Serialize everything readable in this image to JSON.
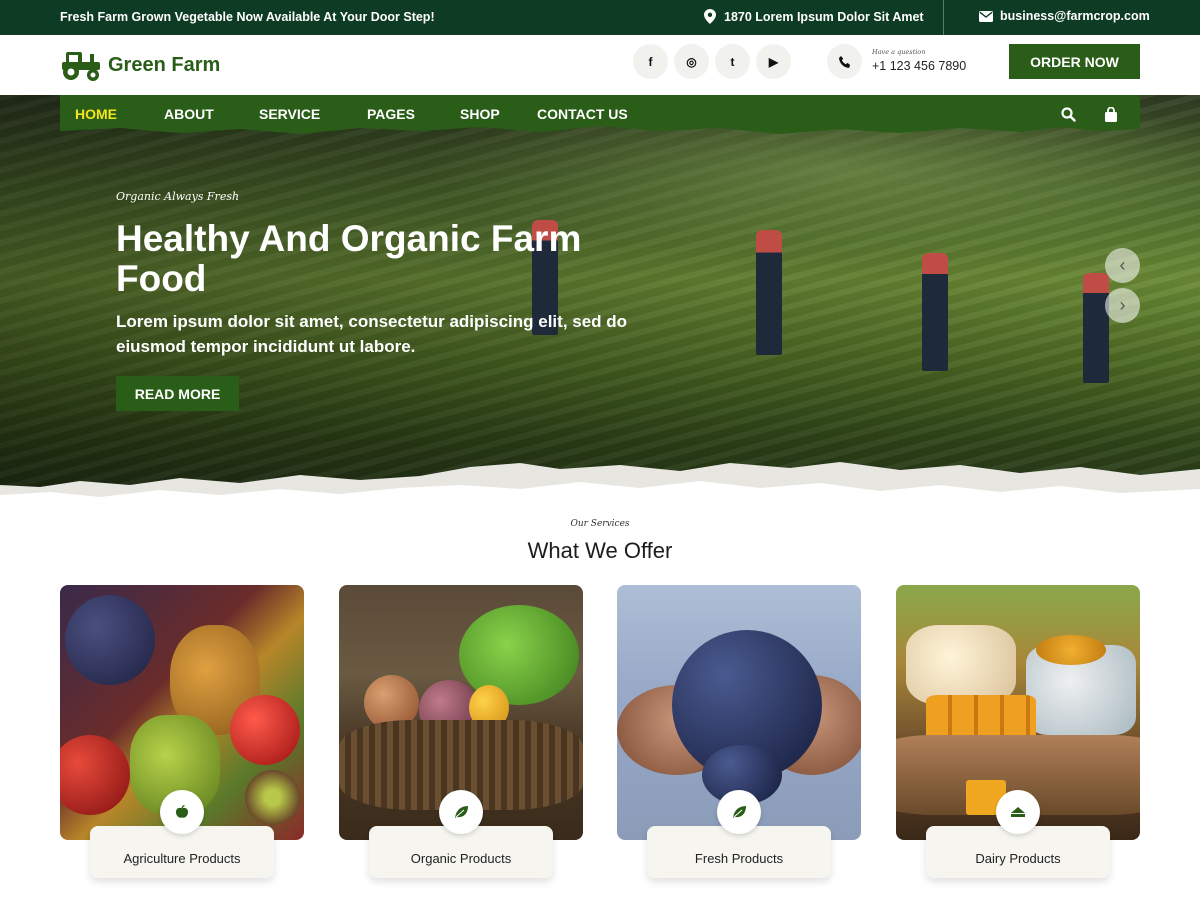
{
  "topbar": {
    "tagline": "Fresh Farm Grown Vegetable Now Available At Your Door Step!",
    "address": "1870 Lorem Ipsum Dolor Sit Amet",
    "email": "business@farmcrop.com"
  },
  "header": {
    "logo_text": "Green Farm",
    "socials": [
      {
        "icon": "facebook-icon",
        "glyph": "f"
      },
      {
        "icon": "instagram-icon",
        "glyph": "◎"
      },
      {
        "icon": "twitter-icon",
        "glyph": "t"
      },
      {
        "icon": "youtube-icon",
        "glyph": "▶"
      }
    ],
    "phone_question": "Have a question",
    "phone_number": "+1 123 456 7890",
    "order_button": "ORDER NOW"
  },
  "nav": {
    "items": [
      {
        "label": "HOME",
        "active": true
      },
      {
        "label": "ABOUT",
        "active": false
      },
      {
        "label": "SERVICE",
        "active": false
      },
      {
        "label": "PAGES",
        "active": false
      },
      {
        "label": "SHOP",
        "active": false
      },
      {
        "label": "CONTACT US",
        "active": false
      }
    ],
    "icons": [
      "search-icon",
      "cart-icon"
    ]
  },
  "hero": {
    "tagline": "Organic Always Fresh",
    "title": "Healthy And Organic Farm Food",
    "description": "Lorem ipsum dolor sit amet, consectetur adipiscing elit, sed do eiusmod tempor incididunt ut labore.",
    "button": "READ MORE"
  },
  "services": {
    "subtitle": "Our Services",
    "title": "What We Offer",
    "cards": [
      {
        "label": "Agriculture Products",
        "icon": "apple-icon"
      },
      {
        "label": "Organic Products",
        "icon": "leaf-icon"
      },
      {
        "label": "Fresh Products",
        "icon": "leaf-icon"
      },
      {
        "label": "Dairy Products",
        "icon": "cheese-icon"
      }
    ]
  },
  "colors": {
    "topbar_bg": "#0e3b24",
    "brand_green": "#2a5d18",
    "nav_active": "#f4e51f",
    "label_bg": "#f6f5ef"
  }
}
